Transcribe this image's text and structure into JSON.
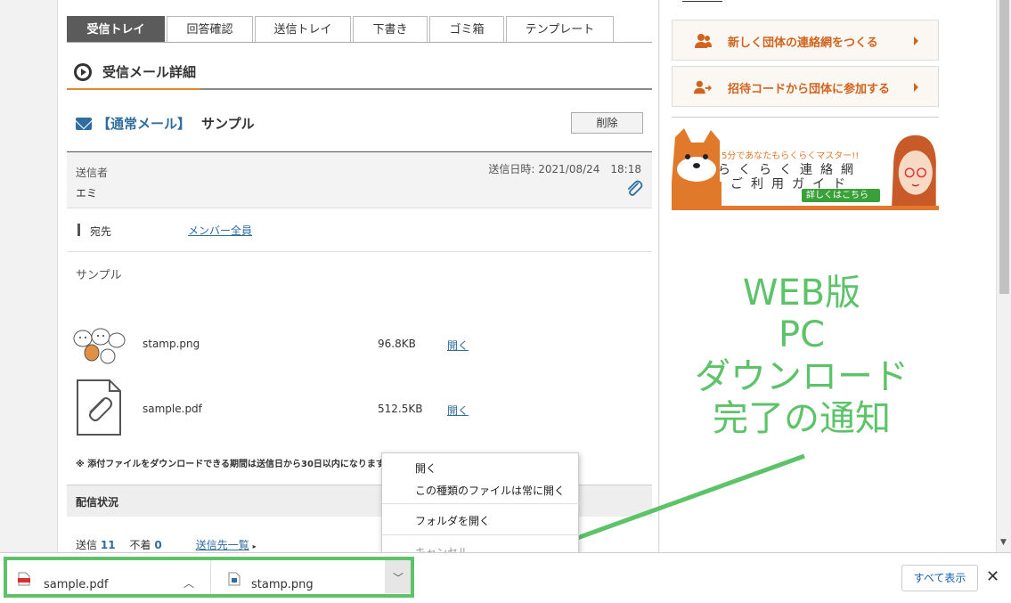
{
  "tabs": [
    "受信トレイ",
    "回答確認",
    "送信トレイ",
    "下書き",
    "ゴミ箱",
    "テンプレート"
  ],
  "section_title": "受信メール詳細",
  "mail": {
    "type_label": "【通常メール】",
    "subject": "サンプル",
    "delete_label": "削除",
    "sender_label": "送信者",
    "sender_name": "エミ",
    "sent_date": "送信日時: 2021/08/24　18:18",
    "to_label": "宛先",
    "to_value": "メンバー全員",
    "body": "サンプル"
  },
  "attachments": [
    {
      "name": "stamp.png",
      "size": "96.8KB",
      "open_label": "開く"
    },
    {
      "name": "sample.pdf",
      "size": "512.5KB",
      "open_label": "開く"
    }
  ],
  "attachment_note": "※ 添付ファイルをダウンロードできる期間は送信日から30日以内になります",
  "delivery": {
    "heading": "配信状況",
    "sent_label": "送信",
    "sent_count": "11",
    "failed_label": "不着",
    "failed_count": "0",
    "list_link": "送信先一覧"
  },
  "sidebar": {
    "buttons": [
      {
        "label": "新しく団体の連絡網をつくる",
        "icon": "person-icon"
      },
      {
        "label": "招待コードから団体に参加する",
        "icon": "person-arrow-icon"
      }
    ],
    "banner": {
      "sub": "5分であなたもらくらくマスター!!",
      "title1": "らくらく連絡網",
      "title2": "ご利用ガイド",
      "link": "詳しくはこちら"
    }
  },
  "overlay": {
    "lines": [
      "WEB版",
      "PC",
      "ダウンロード",
      "完了の通知"
    ],
    "color": "#5cc369"
  },
  "context_menu": {
    "items": [
      "開く",
      "この種類のファイルは常に開く",
      "フォルダを開く",
      "キャンセル"
    ]
  },
  "download_bar": {
    "items": [
      {
        "name": "sample.pdf",
        "icon": "pdf-icon"
      },
      {
        "name": "stamp.png",
        "icon": "image-file-icon"
      }
    ],
    "show_all_label": "すべて表示"
  }
}
